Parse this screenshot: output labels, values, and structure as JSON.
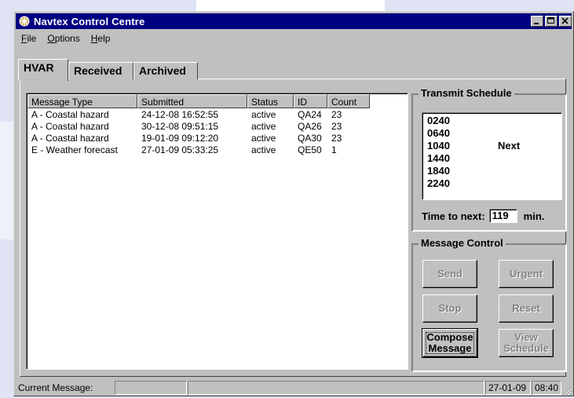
{
  "window": {
    "title": "Navtex Control Centre"
  },
  "menu": [
    {
      "label_u": "F",
      "label_rest": "ile"
    },
    {
      "label_u": "O",
      "label_rest": "ptions"
    },
    {
      "label_u": "H",
      "label_rest": "elp"
    }
  ],
  "tabs": [
    "HVAR",
    "Received",
    "Archived"
  ],
  "messages": {
    "columns": [
      "Message Type",
      "Submitted",
      "Status",
      "ID",
      "Count"
    ],
    "rows": [
      [
        "A - Coastal hazard",
        "24-12-08 16:52:55",
        "active",
        "QA24",
        "23"
      ],
      [
        "A - Coastal hazard",
        "30-12-08 09:51:15",
        "active",
        "QA26",
        "23"
      ],
      [
        "A - Coastal hazard",
        "19-01-09 09:12:20",
        "active",
        "QA30",
        "23"
      ],
      [
        "E - Weather forecast",
        "27-01-09 05:33:25",
        "active",
        "QE50",
        "1"
      ]
    ]
  },
  "transmit": {
    "title": "Transmit Schedule",
    "times": [
      "0240",
      "0640",
      "1040",
      "1440",
      "1840",
      "2240"
    ],
    "next_label": "Next",
    "time_to_next_label": "Time to next:",
    "time_to_next_value": "119",
    "unit": "min."
  },
  "control": {
    "title": "Message Control",
    "send": "Send",
    "urgent": "Urgent",
    "stop": "Stop",
    "reset": "Reset",
    "compose_line1": "Compose",
    "compose_line2": "Message",
    "view_line1": "View",
    "view_line2": "Schedule"
  },
  "status": {
    "label": "Current Message:",
    "current_message": "",
    "date": "27-01-09",
    "time": "08:40"
  }
}
